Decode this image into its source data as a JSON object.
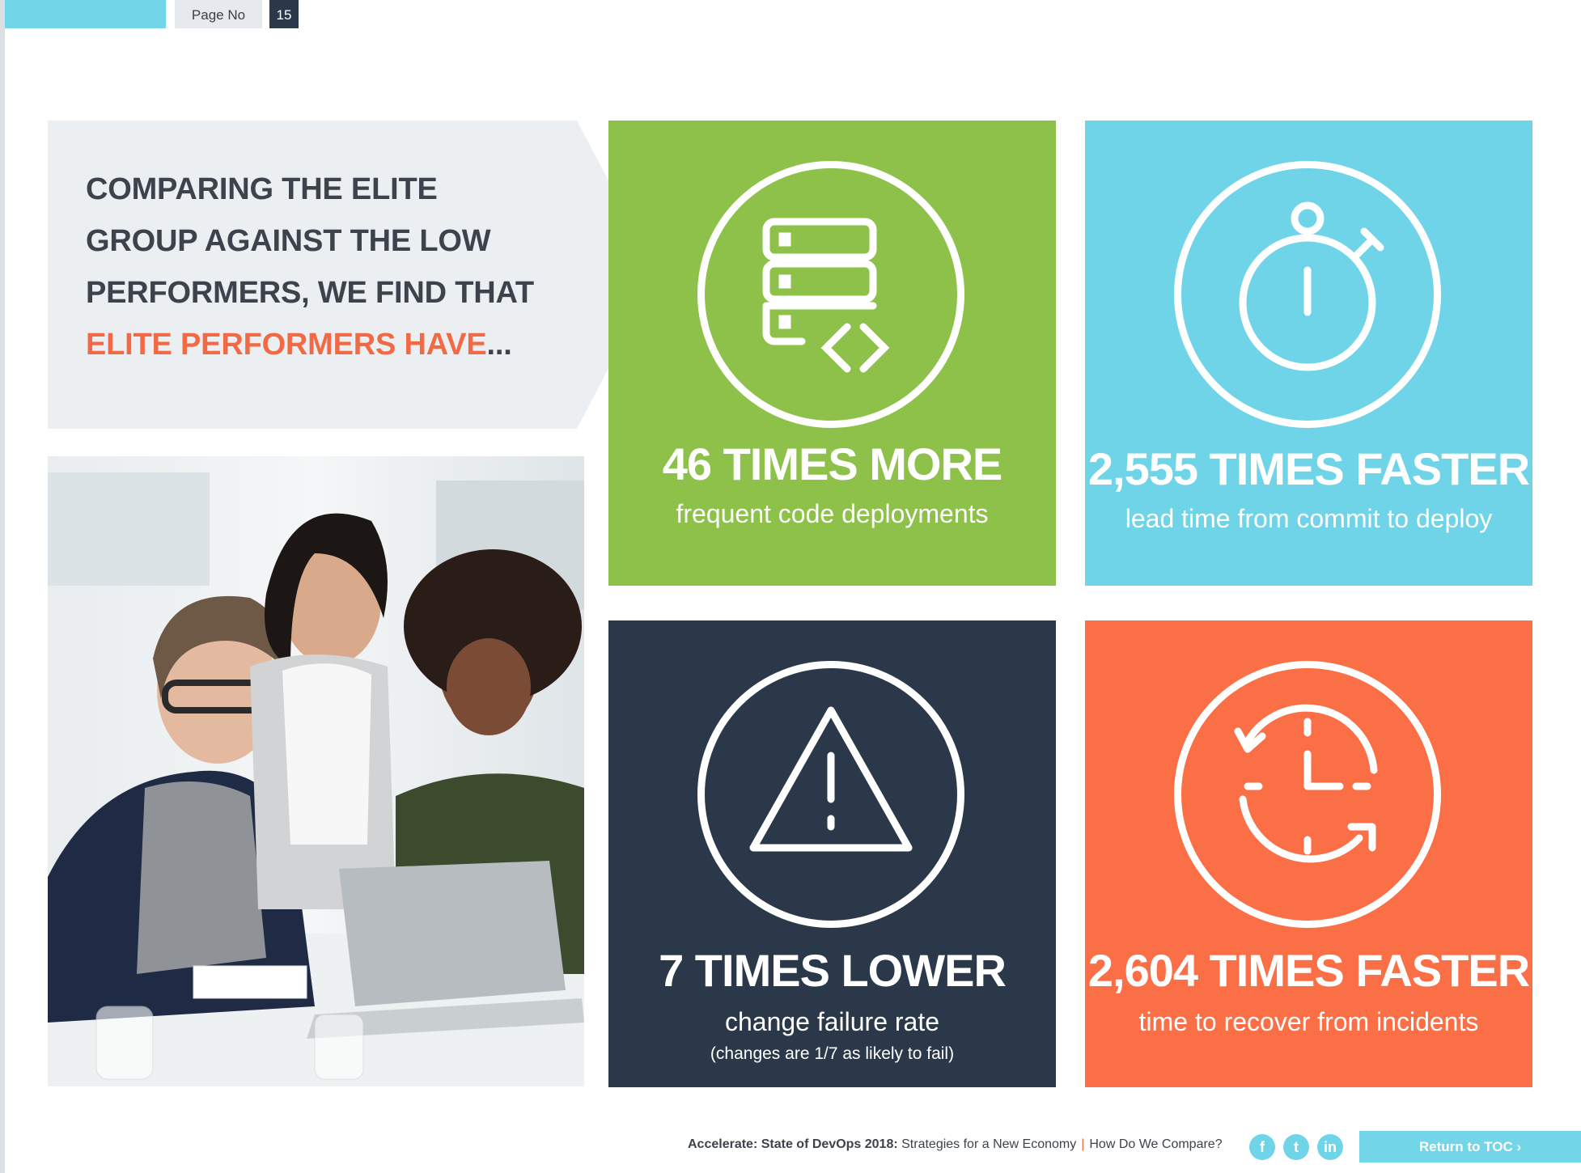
{
  "header": {
    "page_label": "Page No",
    "page_number": "15"
  },
  "intro": {
    "line1": "COMPARING THE ELITE",
    "line2": "GROUP AGAINST THE LOW",
    "line3": "PERFORMERS, WE FIND THAT",
    "line4_accent": "ELITE PERFORMERS HAVE",
    "line4_tail": "..."
  },
  "tiles": [
    {
      "icon": "server-code-icon",
      "headline": "46 TIMES MORE",
      "sub": "frequent code deployments",
      "color": "#8dc14a"
    },
    {
      "icon": "stopwatch-icon",
      "headline": "2,555 TIMES FASTER",
      "sub": "lead time from commit to deploy",
      "color": "#6fd4e8"
    },
    {
      "icon": "warning-triangle-icon",
      "headline": "7 TIMES LOWER",
      "sub": "change failure rate",
      "note": "(changes are 1/7 as likely to fail)",
      "color": "#2b3849"
    },
    {
      "icon": "clock-recovery-icon",
      "headline": "2,604 TIMES FASTER",
      "sub": "time to recover from incidents",
      "color": "#fb6f47"
    }
  ],
  "footer": {
    "title_bold": "Accelerate: State of DevOps 2018:",
    "title_rest": "Strategies for a New Economy",
    "separator": "|",
    "section": "How Do We Compare?",
    "social": [
      "f",
      "t",
      "in"
    ],
    "toc_label": "Return to TOC ›"
  }
}
